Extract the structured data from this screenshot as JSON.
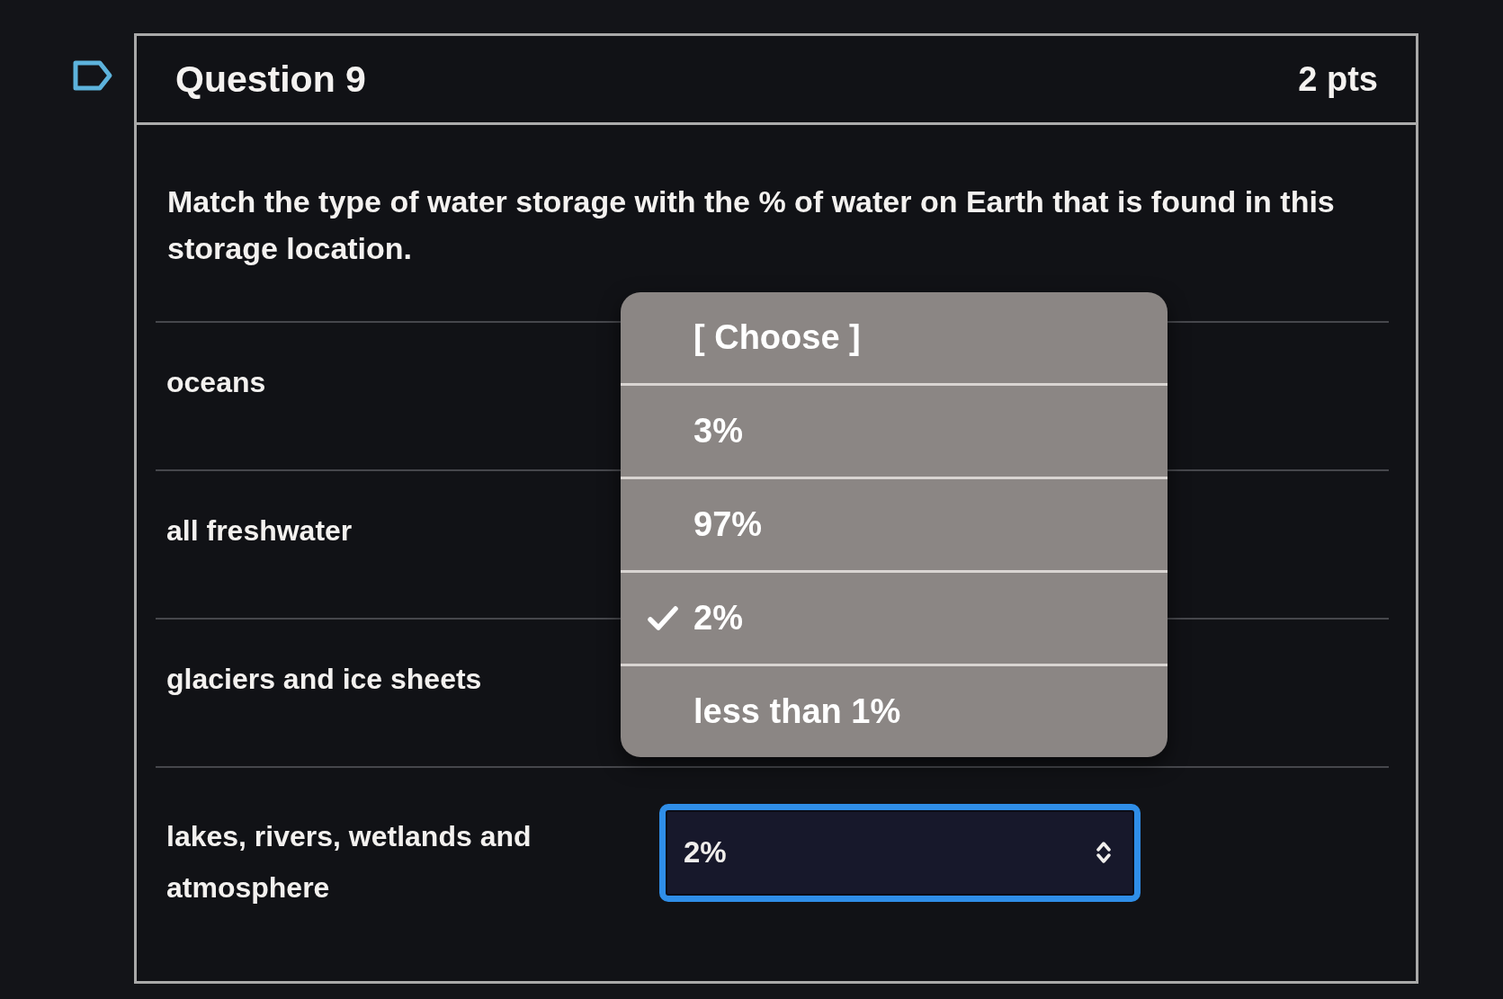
{
  "question": {
    "title": "Question 9",
    "points": "2 pts"
  },
  "prompt": "Match the type of water storage with the % of water on Earth that is found in this storage location.",
  "matches": [
    {
      "label": "oceans"
    },
    {
      "label": "all freshwater"
    },
    {
      "label": "glaciers and ice sheets"
    },
    {
      "label": "lakes, rivers, wetlands and atmosphere",
      "answer": {
        "value": "2%",
        "focused": true
      }
    }
  ],
  "dropdown": {
    "options": [
      {
        "label": "[ Choose ]",
        "selected": false
      },
      {
        "label": "3%",
        "selected": false
      },
      {
        "label": "97%",
        "selected": false
      },
      {
        "label": "2%",
        "selected": true
      },
      {
        "label": "less than 1%",
        "selected": false
      }
    ]
  }
}
